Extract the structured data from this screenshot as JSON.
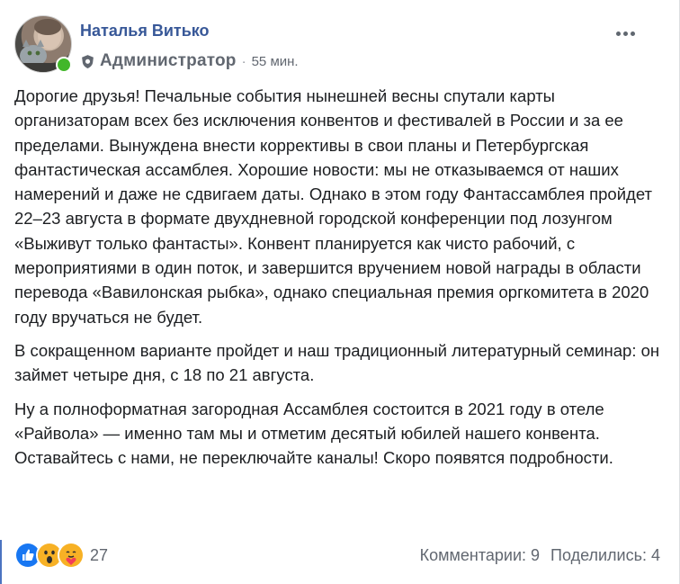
{
  "post": {
    "author": {
      "name": "Наталья Витько",
      "online": true,
      "role": "Администратор",
      "role_icon": "gear-shield-icon",
      "separator": "·",
      "time": "55 мин."
    },
    "more_icon": "ellipsis-icon",
    "paragraphs": [
      "Дорогие друзья! Печальные события нынешней весны спутали карты организаторам всех без исключения конвентов и фестивалей в России и за ее пределами. Вынуждена внести коррективы в свои планы и Петербургская фантастическая ассамблея. Хорошие новости: мы не отказываемся от наших намерений и даже не сдвигаем даты. Однако в этом году Фантассамблея пройдет 22–23 августа в формате двухдневной городской конференции под лозунгом «Выживут только фантасты». Конвент планируется как чисто рабочий, с мероприятиями в один поток, и завершится вручением новой награды в области перевода «Вавилонская рыбка», однако специальная премия оргкомитета в 2020 году вручаться не будет.",
      "В сокращенном варианте пройдет и наш традиционный литературный семинар: он займет четыре дня, с 18 по 21 августа.",
      "Ну а полноформатная загородная Ассамблея состоится в 2021 году в отеле «Райвола» — именно там мы и отметим десятый юбилей нашего конвента. Оставайтесь с нами, не переключайте каналы! Скоро появятся подробности."
    ],
    "reactions": {
      "icons": [
        "like-icon",
        "wow-icon",
        "care-icon"
      ],
      "count": "27"
    },
    "comments": "Комментарии: 9",
    "shares": "Поделились: 4"
  },
  "colors": {
    "name": "#385898",
    "online": "#42b72a",
    "secondary": "#616770",
    "like": "#1877f2",
    "wow": "#f7b125"
  }
}
